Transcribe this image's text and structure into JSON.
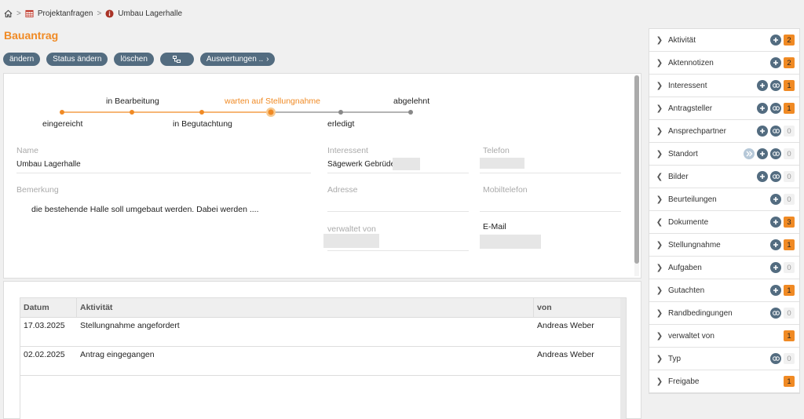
{
  "breadcrumb": {
    "items": [
      {
        "label": "Projektanfragen"
      },
      {
        "label": "Umbau Lagerhalle"
      }
    ]
  },
  "page": {
    "title": "Bauantrag"
  },
  "toolbar": {
    "edit": "ändern",
    "change_status": "Status ändern",
    "delete": "löschen",
    "reports": "Auswertungen .."
  },
  "workflow": {
    "steps": [
      {
        "label": "eingereicht",
        "state": "done"
      },
      {
        "label": "in Bearbeitung",
        "state": "done"
      },
      {
        "label": "in Begutachtung",
        "state": "done"
      },
      {
        "label": "warten auf Stellungnahme",
        "state": "current"
      },
      {
        "label": "erledigt",
        "state": "pending"
      },
      {
        "label": "abgelehnt",
        "state": "pending"
      }
    ]
  },
  "fields": {
    "name_label": "Name",
    "name_value": "Umbau Lagerhalle",
    "remark_label": "Bemerkung",
    "remark_value": "die bestehende Halle soll umgebaut werden. Dabei werden ....",
    "interessent_label": "Interessent",
    "interessent_value": "Sägewerk Gebrüder",
    "address_label": "Adresse",
    "managed_label": "verwaltet von",
    "phone_label": "Telefon",
    "mobile_label": "Mobiltelefon",
    "email_label": "E-Mail"
  },
  "activities": {
    "columns": [
      "Datum",
      "Aktivität",
      "von"
    ],
    "rows": [
      {
        "date": "17.03.2025",
        "activity": "Stellungnahme angefordert",
        "by": "Andreas Weber"
      },
      {
        "date": "02.02.2025",
        "activity": "Antrag eingegangen",
        "by": "Andreas Weber"
      }
    ]
  },
  "sidebar": {
    "items": [
      {
        "label": "Aktivität",
        "count": "2"
      },
      {
        "label": "Aktennotizen",
        "count": "2"
      },
      {
        "label": "Interessent",
        "count": "1"
      },
      {
        "label": "Antragsteller",
        "count": "1"
      },
      {
        "label": "Ansprechpartner",
        "count": "0"
      },
      {
        "label": "Standort",
        "count": "0"
      },
      {
        "label": "Bilder",
        "count": "0"
      },
      {
        "label": "Beurteilungen",
        "count": "0"
      },
      {
        "label": "Dokumente",
        "count": "3"
      },
      {
        "label": "Stellungnahme",
        "count": "1"
      },
      {
        "label": "Aufgaben",
        "count": "0"
      },
      {
        "label": "Gutachten",
        "count": "1"
      },
      {
        "label": "Randbedingungen",
        "count": "0"
      },
      {
        "label": "verwaltet von",
        "count": "1"
      },
      {
        "label": "Typ",
        "count": "0"
      },
      {
        "label": "Freigabe",
        "count": "1"
      }
    ]
  },
  "colors": {
    "accent": "#f08a24",
    "primary": "#536c80",
    "pending": "#888888"
  }
}
